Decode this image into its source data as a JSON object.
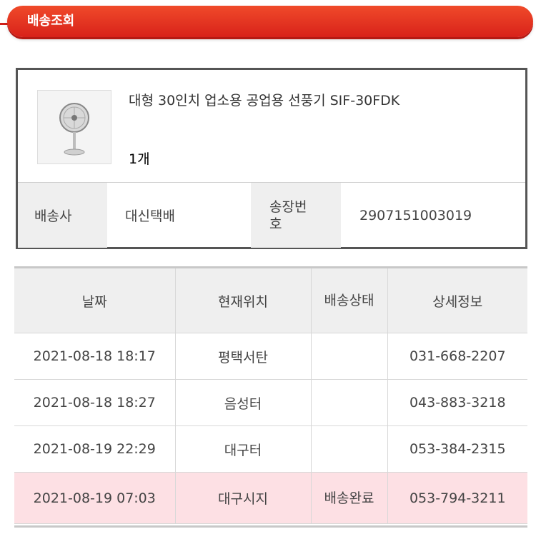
{
  "header": {
    "title": "배송조회"
  },
  "product": {
    "name": "대형 30인치 업소용 공업용 선풍기 SIF-30FDK",
    "quantity": "1개",
    "image_icon": "electric-fan-image"
  },
  "shipping": {
    "carrier_label": "배송사",
    "carrier_value": "대신택배",
    "invoice_label": "송장번호",
    "invoice_value": "2907151003019"
  },
  "tracking": {
    "columns": [
      "날짜",
      "현재위치",
      "배송상태",
      "상세정보"
    ],
    "rows": [
      {
        "date": "2021-08-18 18:17",
        "location": "평택서탄",
        "status": "",
        "detail": "031-668-2207"
      },
      {
        "date": "2021-08-18 18:27",
        "location": "음성터",
        "status": "",
        "detail": "043-883-3218"
      },
      {
        "date": "2021-08-19 22:29",
        "location": "대구터",
        "status": "",
        "detail": "053-384-2315"
      },
      {
        "date": "2021-08-19 07:03",
        "location": "대구시지",
        "status": "배송완료",
        "detail": "053-794-3211"
      }
    ]
  },
  "colors": {
    "banner": "#e0281d",
    "highlight_row": "#fde0e4",
    "label_bg": "#efefef"
  }
}
